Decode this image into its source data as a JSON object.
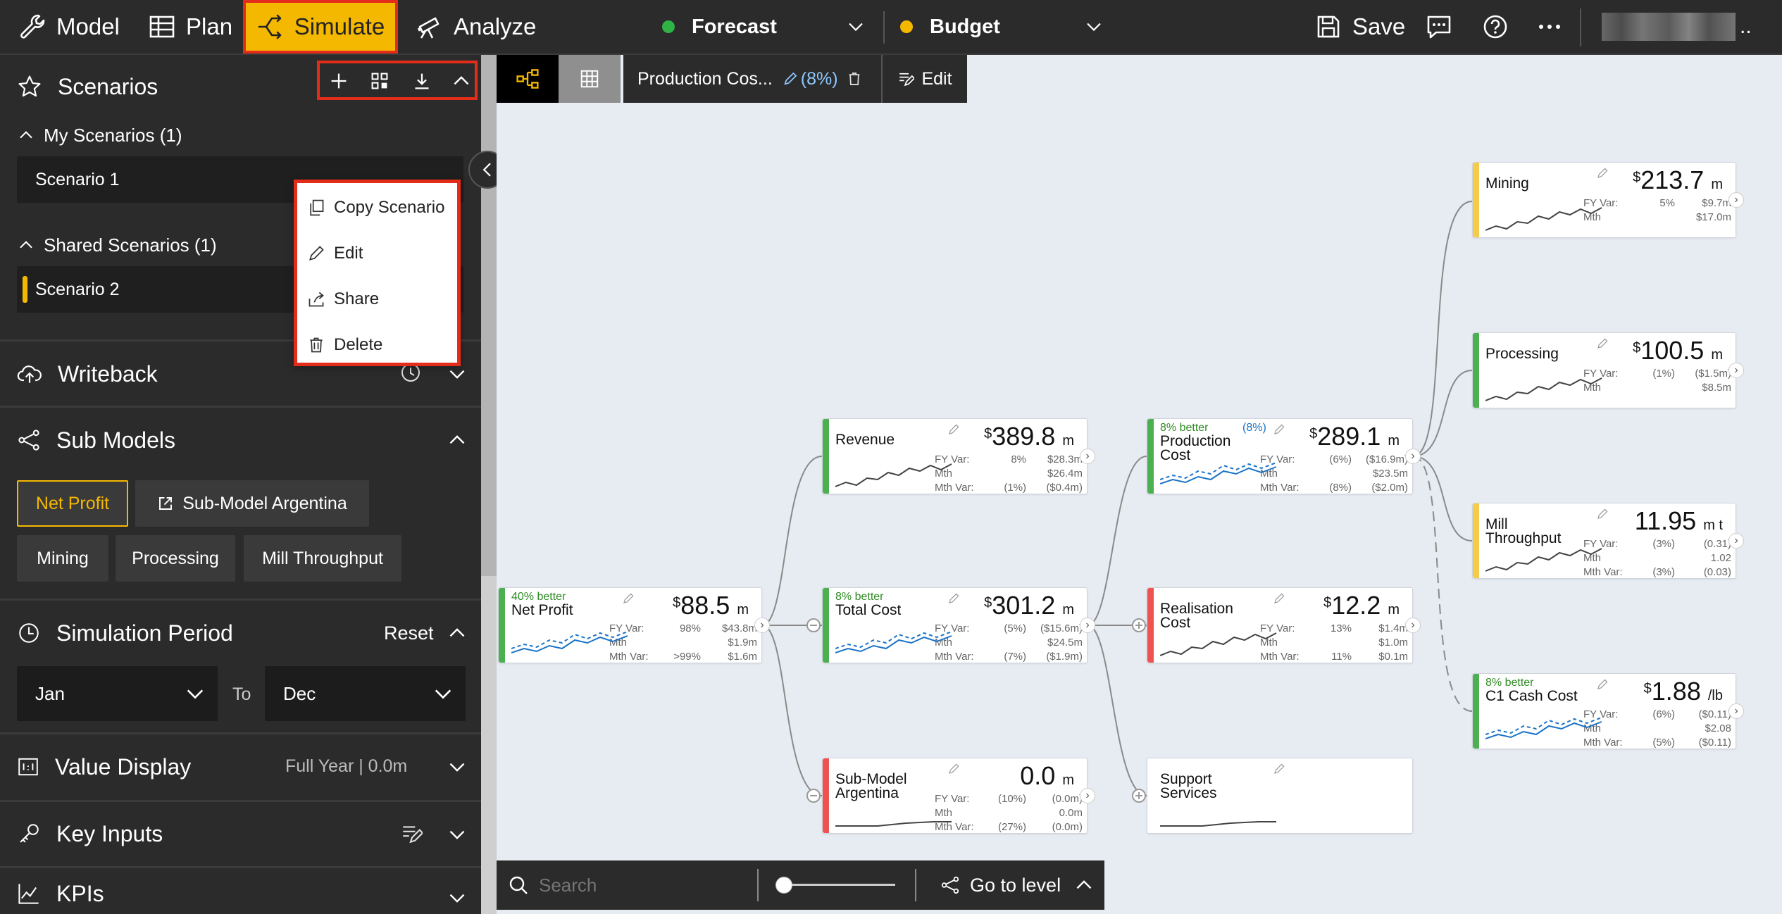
{
  "topbar": {
    "model": "Model",
    "plan": "Plan",
    "simulate": "Simulate",
    "analyze": "Analyze",
    "forecast": "Forecast",
    "forecast_color": "#2fb344",
    "budget": "Budget",
    "budget_color": "#f5b800",
    "save": "Save"
  },
  "sidebar": {
    "scenarios_title": "Scenarios",
    "my_scenarios": "My Scenarios (1)",
    "scenario1": "Scenario 1",
    "shared_scenarios": "Shared Scenarios (1)",
    "scenario2": "Scenario 2",
    "writeback": "Writeback",
    "submodels_title": "Sub Models",
    "submodels": {
      "net_profit": "Net Profit",
      "argentina": "Sub-Model Argentina",
      "mining": "Mining",
      "processing": "Processing",
      "mill": "Mill Throughput"
    },
    "simulation_period": "Simulation Period",
    "reset": "Reset",
    "from": "Jan",
    "to_label": "To",
    "to": "Dec",
    "value_display": "Value Display",
    "value_display_value": "Full Year | 0.0m",
    "key_inputs": "Key Inputs",
    "kpis": "KPIs"
  },
  "context_menu": {
    "copy": "Copy Scenario",
    "edit": "Edit",
    "share": "Share",
    "delete": "Delete"
  },
  "canvas_tabs": {
    "scenario_tab": "Production Cos...",
    "scenario_pct": "(8%)",
    "edit": "Edit"
  },
  "nodes": {
    "net_profit": {
      "name": "Net Profit",
      "better": "40% better",
      "cur": "$",
      "value": "88.5",
      "unit": "m",
      "rows": [
        [
          "FY Var:",
          "98%",
          "$43.8m"
        ],
        [
          "Mth",
          "",
          "$1.9m"
        ],
        [
          "Mth Var:",
          ">99%",
          "$1.6m"
        ]
      ]
    },
    "revenue": {
      "name": "Revenue",
      "better": "",
      "cur": "$",
      "value": "389.8",
      "unit": "m",
      "rows": [
        [
          "FY Var:",
          "8%",
          "$28.3m"
        ],
        [
          "Mth",
          "",
          "$26.4m"
        ],
        [
          "Mth Var:",
          "(1%)",
          "($0.4m)"
        ]
      ]
    },
    "total_cost": {
      "name": "Total Cost",
      "better": "8% better",
      "cur": "$",
      "value": "301.2",
      "unit": "m",
      "rows": [
        [
          "FY Var:",
          "(5%)",
          "($15.6m)"
        ],
        [
          "Mth",
          "",
          "$24.5m"
        ],
        [
          "Mth Var:",
          "(7%)",
          "($1.9m)"
        ]
      ]
    },
    "sub_model_argentina": {
      "name": "Sub-Model\nArgentina",
      "better": "",
      "cur": "",
      "value": "0.0",
      "unit": "m",
      "rows": [
        [
          "FY Var:",
          "(10%)",
          "(0.0m)"
        ],
        [
          "Mth",
          "",
          "0.0m"
        ],
        [
          "Mth Var:",
          "(27%)",
          "(0.0m)"
        ]
      ]
    },
    "production_cost": {
      "name": "Production\nCost",
      "better": "8% better",
      "edit_pct": "(8%)",
      "cur": "$",
      "value": "289.1",
      "unit": "m",
      "rows": [
        [
          "FY Var:",
          "(6%)",
          "($16.9m)"
        ],
        [
          "Mth",
          "",
          "$23.5m"
        ],
        [
          "Mth Var:",
          "(8%)",
          "($2.0m)"
        ]
      ]
    },
    "realisation_cost": {
      "name": "Realisation\nCost",
      "better": "",
      "cur": "$",
      "value": "12.2",
      "unit": "m",
      "rows": [
        [
          "FY Var:",
          "13%",
          "$1.4m"
        ],
        [
          "Mth",
          "",
          "$1.0m"
        ],
        [
          "Mth Var:",
          "11%",
          "$0.1m"
        ]
      ]
    },
    "support_services": {
      "name": "Support\nServices",
      "better": "",
      "cur": "",
      "value": "",
      "unit": "",
      "rows": []
    },
    "mining": {
      "name": "Mining",
      "better": "",
      "cur": "$",
      "value": "213.7",
      "unit": "m",
      "rows": [
        [
          "FY Var:",
          "5%",
          "$9.7m"
        ],
        [
          "Mth",
          "",
          "$17.0m"
        ]
      ]
    },
    "processing": {
      "name": "Processing",
      "better": "",
      "cur": "$",
      "value": "100.5",
      "unit": "m",
      "rows": [
        [
          "FY Var:",
          "(1%)",
          "($1.5m)"
        ],
        [
          "Mth",
          "",
          "$8.5m"
        ]
      ]
    },
    "mill_throughput": {
      "name": "Mill\nThroughput",
      "better": "",
      "cur": "",
      "value": "11.95",
      "unit": "m t",
      "rows": [
        [
          "FY Var:",
          "(3%)",
          "(0.31)"
        ],
        [
          "Mth",
          "",
          "1.02"
        ],
        [
          "Mth Var:",
          "(3%)",
          "(0.03)"
        ]
      ]
    },
    "c1_cash_cost": {
      "name": "C1 Cash Cost",
      "better": "8% better",
      "cur": "$",
      "value": "1.88",
      "unit": "/lb",
      "rows": [
        [
          "FY Var:",
          "(6%)",
          "($0.11)"
        ],
        [
          "Mth",
          "",
          "$2.08"
        ],
        [
          "Mth Var:",
          "(5%)",
          "($0.11)"
        ]
      ]
    }
  },
  "bottombar": {
    "search_placeholder": "Search",
    "go_to_level": "Go to level"
  }
}
